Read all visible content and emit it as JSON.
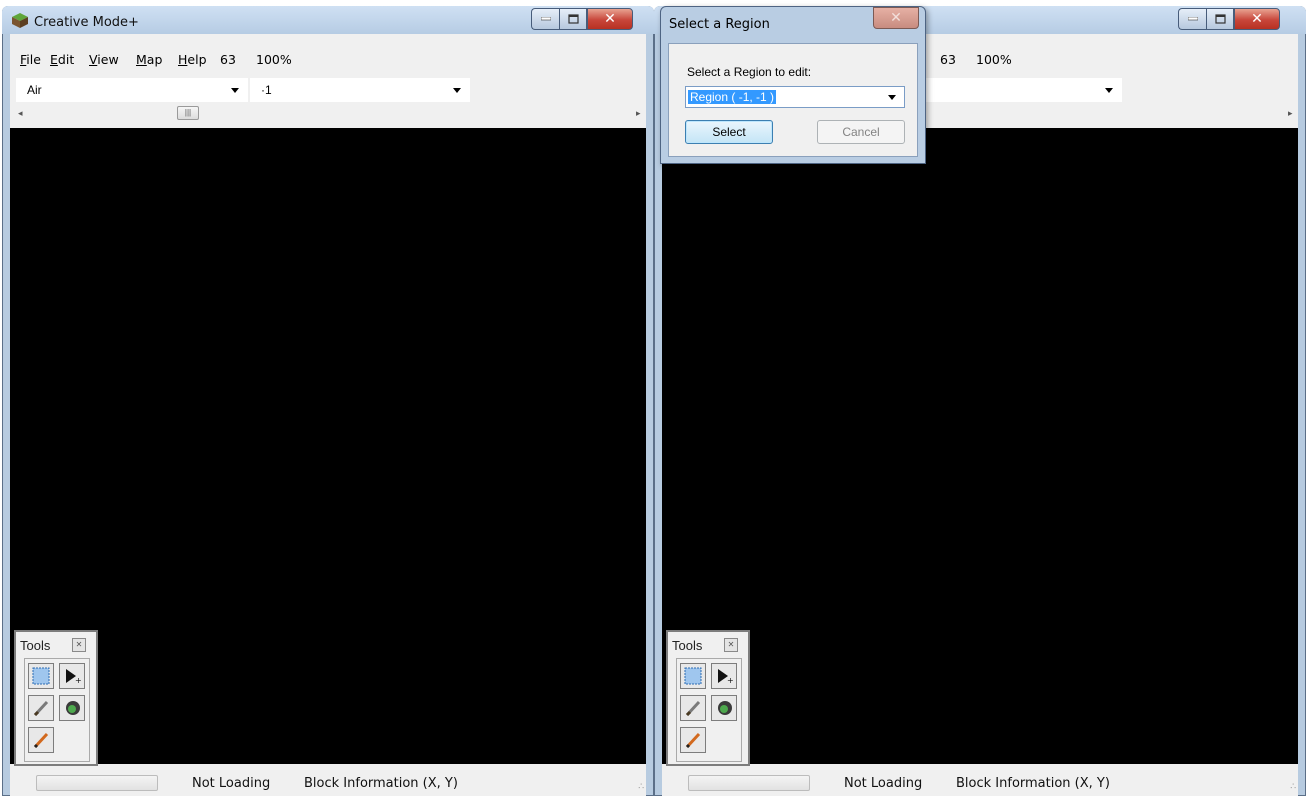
{
  "app": {
    "title": "Creative Mode+",
    "menu": [
      {
        "mnemonic": "F",
        "rest": "ile"
      },
      {
        "mnemonic": "E",
        "rest": "dit"
      },
      {
        "mnemonic": "V",
        "rest": "iew"
      },
      {
        "mnemonic": "M",
        "rest": "ap"
      },
      {
        "mnemonic": "H",
        "rest": "elp"
      }
    ],
    "layer_readout": "63",
    "zoom_readout": "100%",
    "block_combo_value": "Air",
    "layer_combo_value": "·1",
    "tools": {
      "title": "Tools",
      "buttons": [
        "select-rect-icon",
        "move-pointer-icon",
        "brush-icon",
        "fill-bucket-icon",
        "pencil-icon"
      ]
    },
    "status": {
      "loading_text": "Not Loading",
      "block_info_text": "Block Information  (X, Y)"
    }
  },
  "dialog": {
    "title": "Select a Region",
    "prompt": "Select a Region to edit:",
    "selected_region": "Region ( -1, -1 )",
    "select_button": "Select",
    "cancel_button": "Cancel"
  },
  "colors": {
    "frame": "#b7cbe0",
    "canvas": "#000000",
    "close_button": "#c8463a",
    "selection_highlight": "#3399ff"
  }
}
